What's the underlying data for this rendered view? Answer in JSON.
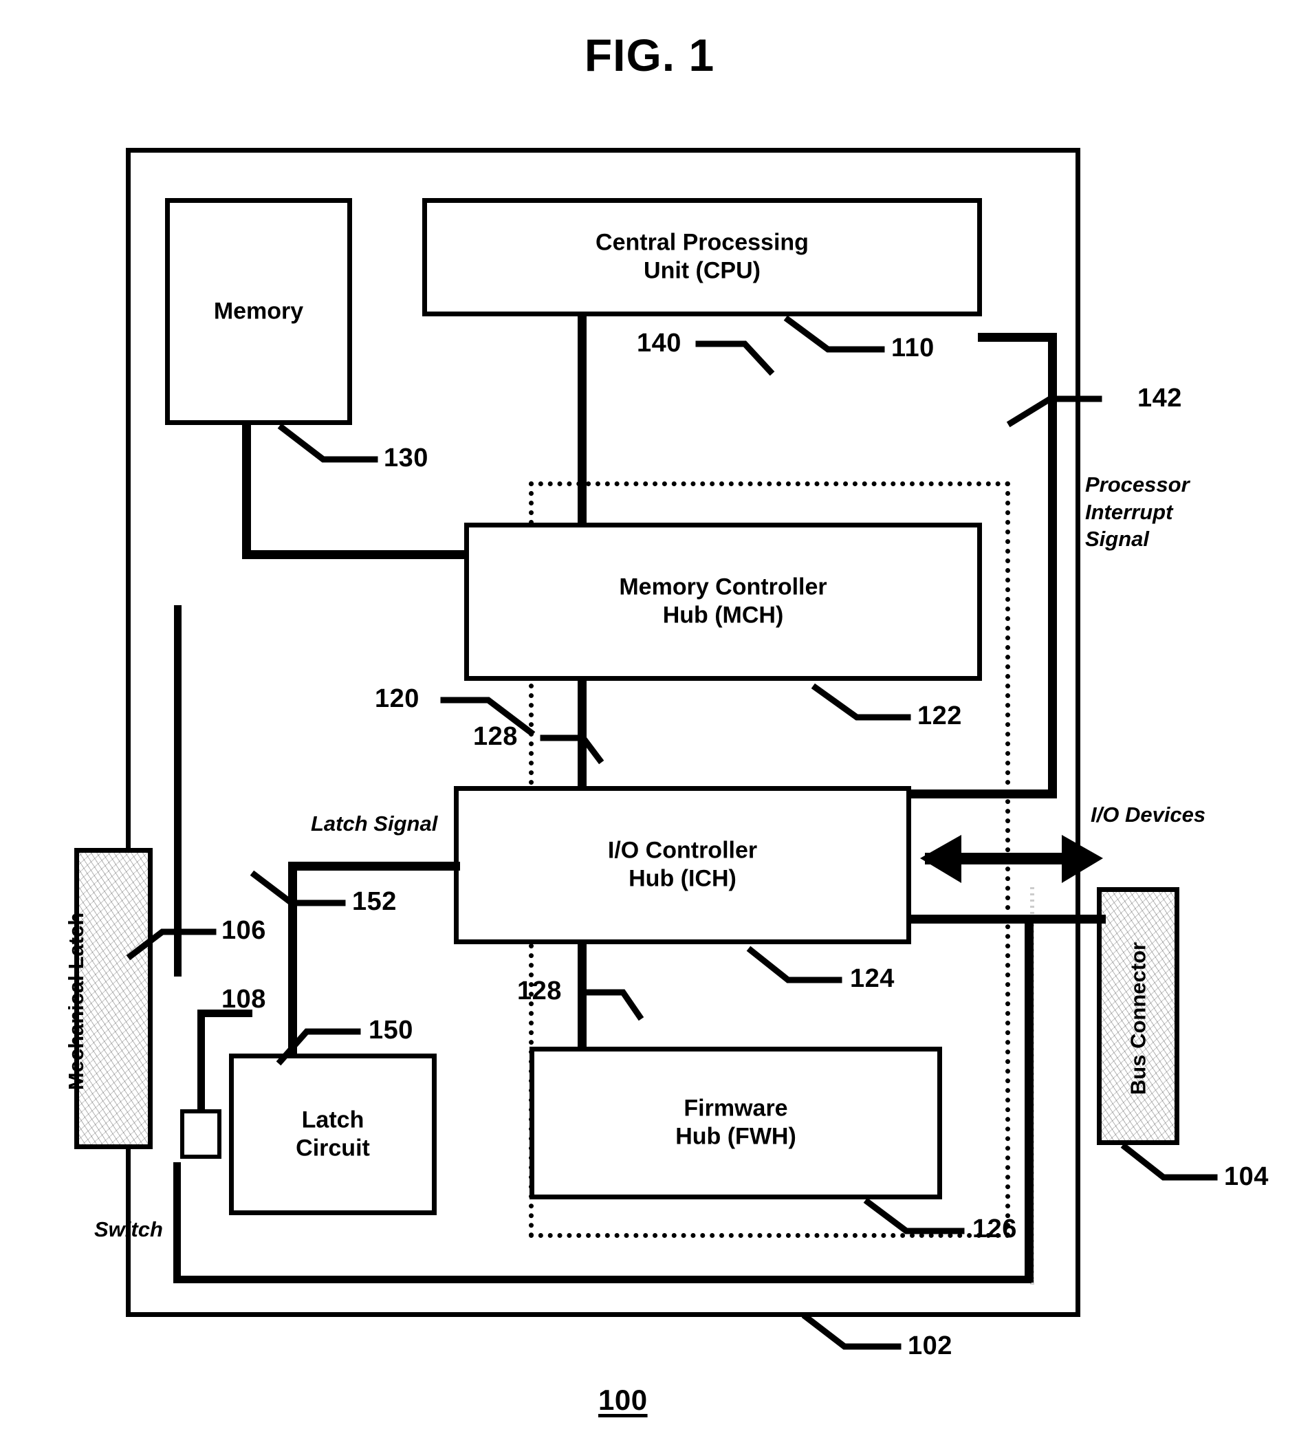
{
  "figure": {
    "title": "FIG. 1",
    "system_ref": "100"
  },
  "blocks": {
    "memory": {
      "label": "Memory",
      "ref": "130"
    },
    "cpu": {
      "label": "Central Processing\nUnit (CPU)",
      "line1": "Central Processing",
      "line2": "Unit (CPU)",
      "ref": "110"
    },
    "mch": {
      "label": "Memory Controller\nHub (MCH)",
      "line1": "Memory Controller",
      "line2": "Hub (MCH)",
      "ref": "122"
    },
    "ich": {
      "label": "I/O Controller\nHub (ICH)",
      "line1": "I/O Controller",
      "line2": "Hub (ICH)",
      "ref": "124"
    },
    "fwh": {
      "label": "Firmware\nHub (FWH)",
      "line1": "Firmware",
      "line2": "Hub (FWH)",
      "ref": "126"
    },
    "latch_circuit": {
      "label": "Latch\nCircuit",
      "line1": "Latch",
      "line2": "Circuit",
      "ref": "150"
    },
    "mechanical_latch": {
      "label": "Mechanical Latch",
      "ref": "106"
    },
    "bus_connector": {
      "label": "Bus Connector",
      "ref": "104"
    },
    "switch": {
      "label": "Switch",
      "ref": "108"
    }
  },
  "boundaries": {
    "chassis": {
      "ref": "102"
    },
    "chipset": {
      "ref": "120"
    }
  },
  "connections": {
    "cpu_to_mch": {
      "ref": "140"
    },
    "mch_to_ich": {
      "ref": "128"
    },
    "ich_to_fwh": {
      "ref": "128"
    },
    "latch_to_ich": {
      "ref": "152"
    },
    "processor_interrupt": {
      "ref": "142"
    }
  },
  "annotations": {
    "processor_interrupt_signal": "Processor\nInterrupt\nSignal",
    "processor_interrupt_line1": "Processor",
    "processor_interrupt_line2": "Interrupt",
    "processor_interrupt_line3": "Signal",
    "latch_signal": "Latch Signal",
    "io_devices": "I/O Devices",
    "switch": "Switch"
  },
  "colors": {
    "ink": "#000000",
    "paper": "#ffffff"
  }
}
